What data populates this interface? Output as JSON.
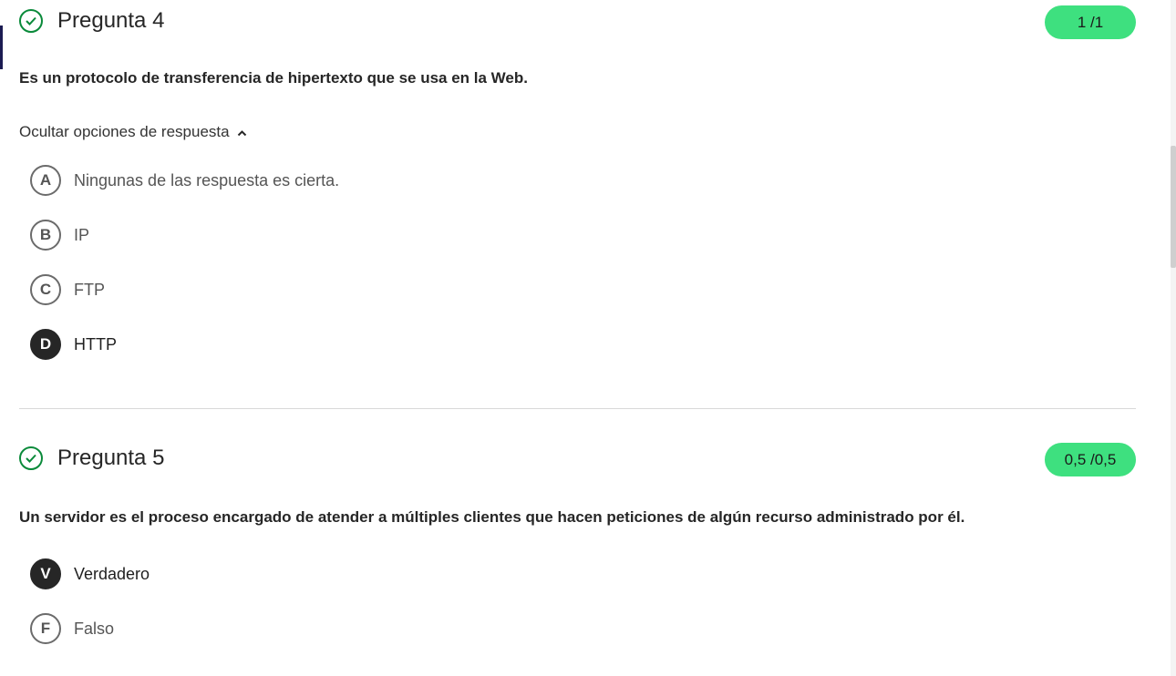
{
  "question4": {
    "title": "Pregunta 4",
    "score": "1 /1",
    "text": "Es un protocolo de transferencia de hipertexto que se usa en la Web.",
    "toggle_label": "Ocultar opciones de respuesta",
    "toggle_icon": "chevron-up-icon",
    "options": [
      {
        "letter": "A",
        "label": "Ningunas de las respuesta es cierta.",
        "selected": false
      },
      {
        "letter": "B",
        "label": "IP",
        "selected": false
      },
      {
        "letter": "C",
        "label": "FTP",
        "selected": false
      },
      {
        "letter": "D",
        "label": "HTTP",
        "selected": true
      }
    ]
  },
  "question5": {
    "title": "Pregunta 5",
    "score": "0,5 /0,5",
    "text": "Un servidor es el proceso encargado de atender a múltiples clientes que hacen peticiones de algún recurso administrado por él.",
    "options": [
      {
        "letter": "V",
        "label": "Verdadero",
        "selected": true
      },
      {
        "letter": "F",
        "label": "Falso",
        "selected": false
      }
    ]
  },
  "colors": {
    "correct_icon": "#0a8a3a",
    "score_badge": "#3ee07f",
    "selected_option": "#262626"
  }
}
